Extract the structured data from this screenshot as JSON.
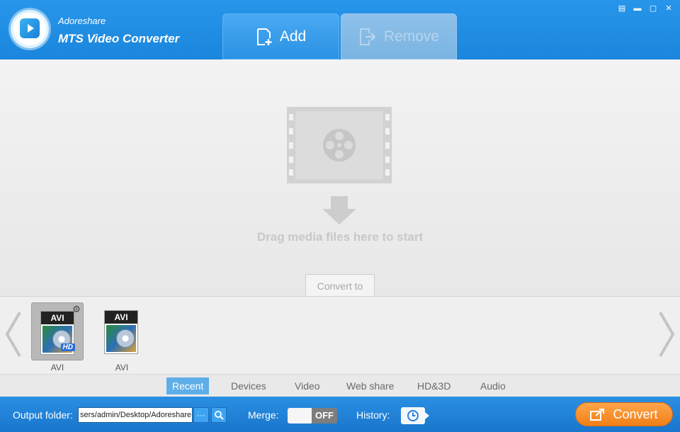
{
  "header": {
    "brand": "Adoreshare",
    "product": "MTS Video Converter",
    "add_label": "Add",
    "remove_label": "Remove"
  },
  "drop": {
    "hint": "Drag media files here to start",
    "convert_to_label": "Convert to"
  },
  "formats": [
    {
      "label": "AVI",
      "cap": "AVI",
      "hd": "HD",
      "selected": true
    },
    {
      "label": "AVI",
      "cap": "AVI",
      "hd": "",
      "selected": false
    }
  ],
  "categories": [
    "Recent",
    "Devices",
    "Video",
    "Web share",
    "HD&3D",
    "Audio"
  ],
  "active_category": "Recent",
  "bottom": {
    "output_label": "Output folder:",
    "output_value": "sers/admin/Desktop/Adoreshare",
    "browse_label": "···",
    "merge_label": "Merge:",
    "merge_state": "OFF",
    "history_label": "History:",
    "convert_label": "Convert"
  },
  "colors": {
    "header_blue": "#1a86dd",
    "convert_orange": "#f07f16",
    "active_tab": "#5faee8"
  }
}
